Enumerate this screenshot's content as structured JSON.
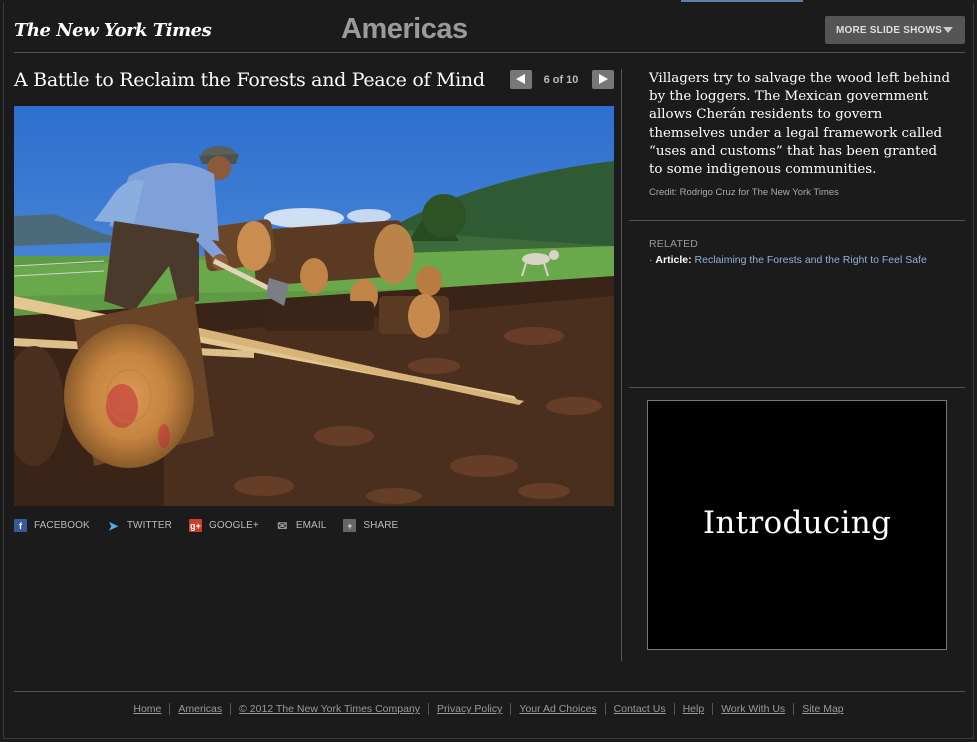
{
  "header": {
    "logo_text": "The New York Times",
    "section_title": "Americas",
    "more_slideshows_label": "MORE SLIDE SHOWS"
  },
  "slideshow": {
    "headline": "A Battle to Reclaim the Forests and Peace of Mind",
    "counter": "6 of 10",
    "current": 6,
    "total": 10
  },
  "share": {
    "items": [
      {
        "label": "FACEBOOK",
        "icon": "facebook-icon"
      },
      {
        "label": "TWITTER",
        "icon": "twitter-icon"
      },
      {
        "label": "GOOGLE+",
        "icon": "google-plus-icon"
      },
      {
        "label": "EMAIL",
        "icon": "email-icon"
      },
      {
        "label": "SHARE",
        "icon": "share-plus-icon"
      }
    ]
  },
  "caption": {
    "text": "Villagers try to salvage the wood left behind by the loggers. The Mexican government allows Cherán residents to govern themselves under a legal framework called “uses and customs” that has been granted to some indigenous communities.",
    "credit": "Credit: Rodrigo Cruz for The New York Times"
  },
  "related": {
    "label": "RELATED",
    "item_kind": "Article:",
    "item_link": "Reclaiming the Forests and the Right to Feel Safe"
  },
  "ad": {
    "text": "Introducing"
  },
  "footer": {
    "links": [
      "Home",
      "Americas",
      "© 2012 The New York Times Company",
      "Privacy Policy",
      "Your Ad Choices",
      "Contact Us",
      "Help",
      "Work With Us",
      "Site Map"
    ]
  },
  "colors": {
    "background": "#1b1b1b",
    "link_blue": "#8fb1d9",
    "section_title_gray": "#9a9a9a"
  }
}
